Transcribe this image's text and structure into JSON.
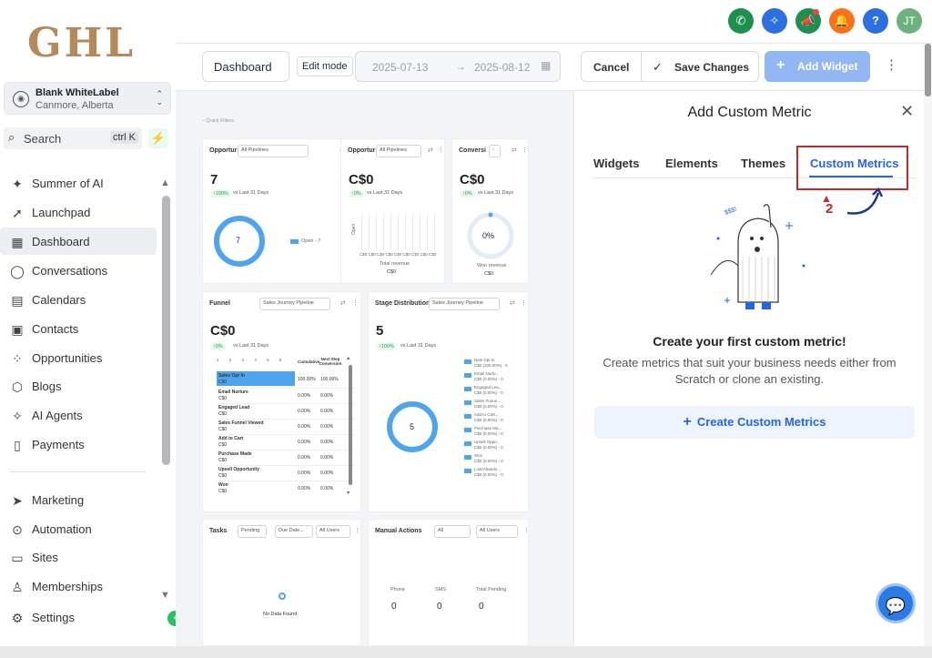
{
  "sidebar": {
    "logo": "GHL",
    "account": {
      "name": "Blank WhiteLabel",
      "location": "Canmore, Alberta"
    },
    "search": {
      "label": "Search",
      "shortcut": "ctrl K"
    },
    "items": [
      {
        "label": "Summer of AI",
        "icon": "sparkle-icon"
      },
      {
        "label": "Launchpad",
        "icon": "rocket-icon"
      },
      {
        "label": "Dashboard",
        "icon": "grid-icon"
      },
      {
        "label": "Conversations",
        "icon": "chat-icon"
      },
      {
        "label": "Calendars",
        "icon": "calendar-icon"
      },
      {
        "label": "Contacts",
        "icon": "contacts-icon"
      },
      {
        "label": "Opportunities",
        "icon": "opportunities-icon"
      },
      {
        "label": "Blogs",
        "icon": "cube-icon"
      },
      {
        "label": "AI Agents",
        "icon": "sparkle-icon"
      },
      {
        "label": "Payments",
        "icon": "receipt-icon"
      },
      {
        "label": "Marketing",
        "icon": "send-icon"
      },
      {
        "label": "Automation",
        "icon": "automation-icon"
      },
      {
        "label": "Sites",
        "icon": "sites-icon"
      },
      {
        "label": "Memberships",
        "icon": "membership-icon"
      },
      {
        "label": "Settings",
        "icon": "gear-icon"
      }
    ]
  },
  "topbar": {
    "icons": [
      "phone-icon",
      "magic-icon",
      "megaphone-icon",
      "bell-icon",
      "help-icon"
    ],
    "avatar": "JT",
    "colors": {
      "phone": "#1f8f4e",
      "magic": "#2c6fe0",
      "megaphone": "#1f8f4e",
      "bell": "#f97316",
      "help": "#2c6fe0",
      "avatar": "#6bb37a"
    }
  },
  "toolbar": {
    "dashboard": "Dashboard",
    "edit_mode": "Edit mode",
    "date_from": "2025-07-13",
    "date_arrow": "→",
    "date_to": "2025-08-12",
    "cancel": "Cancel",
    "save": "Save Changes",
    "add_widget": "Add Widget"
  },
  "canvas": {
    "quick_filters": "‹ Quick Filters",
    "card1": {
      "title": "Opportur",
      "filter": "All Pipelines",
      "value": "7",
      "change": "↑100%",
      "vs": "vs Last 31 Days",
      "donut": "7",
      "legend": "Open - 7"
    },
    "card2": {
      "title": "Opportur",
      "filter": "All Pipelines",
      "value": "C$0",
      "change": "↑0%",
      "vs": "vs Last 31 Days",
      "axis": "C$0 C$0 C$0 C$0 C$0 C$0 C$0 C$0 C$0",
      "total_label": "Total revenue",
      "total": "C$0",
      "y": "Open"
    },
    "card3": {
      "title": "Conversi",
      "value": "C$0",
      "change": "↑0%",
      "vs": "vs Last 31 Days",
      "donut": "0%",
      "won_label": "Won revenue",
      "won": "C$0"
    },
    "funnel": {
      "title": "Funnel",
      "filter": "Sales Journey Pipeline",
      "value": "C$0",
      "change": "↑0%",
      "vs": "vs Last 31 Days",
      "cols": [
        "Cumulative",
        "Next Step Conversion"
      ],
      "steps": [
        "1",
        "2",
        "3",
        "4",
        "5",
        "6"
      ],
      "rows": [
        {
          "name": "Sales Opt In",
          "value": "C$0",
          "cum": "100.00%",
          "next": "100.00%"
        },
        {
          "name": "Email Nurture",
          "value": "C$0",
          "cum": "0.00%",
          "next": "0.00%"
        },
        {
          "name": "Engaged Lead",
          "value": "C$0",
          "cum": "0.00%",
          "next": "0.00%"
        },
        {
          "name": "Sales Funnel Viewed",
          "value": "C$0",
          "cum": "0.00%",
          "next": "0.00%"
        },
        {
          "name": "Add to Cart",
          "value": "C$0",
          "cum": "0.00%",
          "next": "0.00%"
        },
        {
          "name": "Purchase Made",
          "value": "C$0",
          "cum": "0.00%",
          "next": "0.00%"
        },
        {
          "name": "Upsell Opportunity",
          "value": "C$0",
          "cum": "0.00%",
          "next": "0.00%"
        },
        {
          "name": "Won",
          "value": "C$0",
          "cum": "0.00%",
          "next": "0.00%"
        }
      ]
    },
    "stage": {
      "title": "Stage Distribution",
      "filter": "Sales Journey Pipeline",
      "value": "5",
      "change": "↑100%",
      "vs": "vs Last 31 Days",
      "donut": "5",
      "legend": [
        {
          "name": "New Opt In",
          "value": "C$0 (100.00%) - 5"
        },
        {
          "name": "Email Nurtu...",
          "value": "C$0 (0.00%) - 0"
        },
        {
          "name": "Engaged Lea...",
          "value": "C$0 (0.00%) - 0"
        },
        {
          "name": "Sales Funne...",
          "value": "C$0 (0.00%) - 0"
        },
        {
          "name": "Add to Cart...",
          "value": "C$0 (0.00%) - 0"
        },
        {
          "name": "Purchase Ma...",
          "value": "C$0 (0.00%) - 0"
        },
        {
          "name": "Upsell Oppo...",
          "value": "C$0 (0.00%) - 0"
        },
        {
          "name": "Won",
          "value": "C$0 (0.00%) - 0"
        },
        {
          "name": "Lost/Abando...",
          "value": "C$0 (0.00%) - 0"
        }
      ]
    },
    "tasks": {
      "title": "Tasks",
      "f1": "Pending",
      "f2": "Due Date...",
      "f3": "All Users",
      "empty": "No Data Found"
    },
    "manual": {
      "title": "Manual Actions",
      "f1": "All",
      "f2": "All Users",
      "cols": [
        "Phone",
        "SMS",
        "Total Pending"
      ],
      "values": [
        "0",
        "0",
        "0"
      ]
    }
  },
  "panel": {
    "title": "Add Custom Metric",
    "tabs": [
      "Widgets",
      "Elements",
      "Themes",
      "Custom Metrics"
    ],
    "active_tab": "Custom Metrics",
    "step": "2",
    "heading": "Create your first custom metric!",
    "description": "Create metrics that suit your business needs either from Scratch or clone an existing.",
    "button": "Create Custom Metrics",
    "illustration_text": "$$$!",
    "highlight_color": "#c82828"
  }
}
